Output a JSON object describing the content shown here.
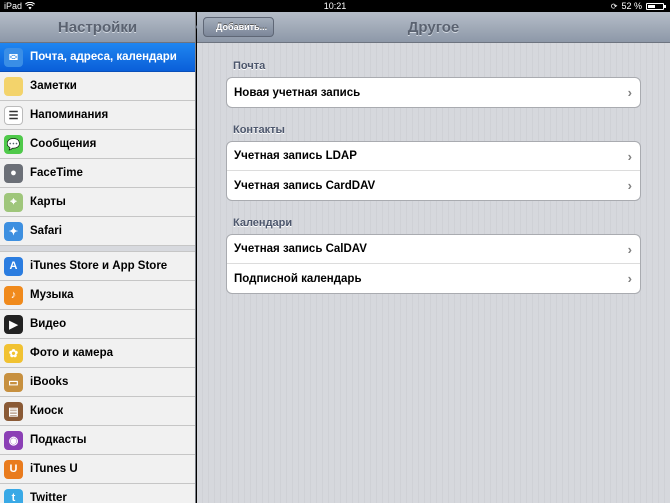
{
  "status": {
    "device": "iPad",
    "time": "10:21",
    "battery": "52 %",
    "battery_fraction": 0.52
  },
  "sidebar": {
    "title": "Настройки",
    "items": [
      {
        "label": "Почта, адреса, календари",
        "icon": "mail-icon",
        "color": "#3a8ee6",
        "selected": true
      },
      {
        "label": "Заметки",
        "icon": "notes-icon",
        "color": "#f3d36b"
      },
      {
        "label": "Напоминания",
        "icon": "reminders-icon",
        "color": "#ffffff"
      },
      {
        "label": "Сообщения",
        "icon": "messages-icon",
        "color": "#4fc94a"
      },
      {
        "label": "FaceTime",
        "icon": "facetime-icon",
        "color": "#6b6f77"
      },
      {
        "label": "Карты",
        "icon": "maps-icon",
        "color": "#9fc67b"
      },
      {
        "label": "Safari",
        "icon": "safari-icon",
        "color": "#3d8fe0"
      },
      {
        "label": "iTunes Store и App Store",
        "icon": "app-store-icon",
        "color": "#2b7de0"
      },
      {
        "label": "Музыка",
        "icon": "music-icon",
        "color": "#f08a1c"
      },
      {
        "label": "Видео",
        "icon": "video-icon",
        "color": "#222222"
      },
      {
        "label": "Фото и камера",
        "icon": "photos-icon",
        "color": "#f1c232"
      },
      {
        "label": "iBooks",
        "icon": "ibooks-icon",
        "color": "#c7903f"
      },
      {
        "label": "Киоск",
        "icon": "newsstand-icon",
        "color": "#8a5a36"
      },
      {
        "label": "Подкасты",
        "icon": "podcasts-icon",
        "color": "#8b3fb5"
      },
      {
        "label": "iTunes U",
        "icon": "itunes-u-icon",
        "color": "#e97b1d"
      },
      {
        "label": "Twitter",
        "icon": "twitter-icon",
        "color": "#39a9e6"
      }
    ]
  },
  "detail": {
    "back_label": "Добавить...",
    "title": "Другое",
    "sections": [
      {
        "header": "Почта",
        "rows": [
          "Новая учетная запись"
        ]
      },
      {
        "header": "Контакты",
        "rows": [
          "Учетная запись LDAP",
          "Учетная запись CardDAV"
        ]
      },
      {
        "header": "Календари",
        "rows": [
          "Учетная запись CalDAV",
          "Подписной календарь"
        ]
      }
    ]
  }
}
